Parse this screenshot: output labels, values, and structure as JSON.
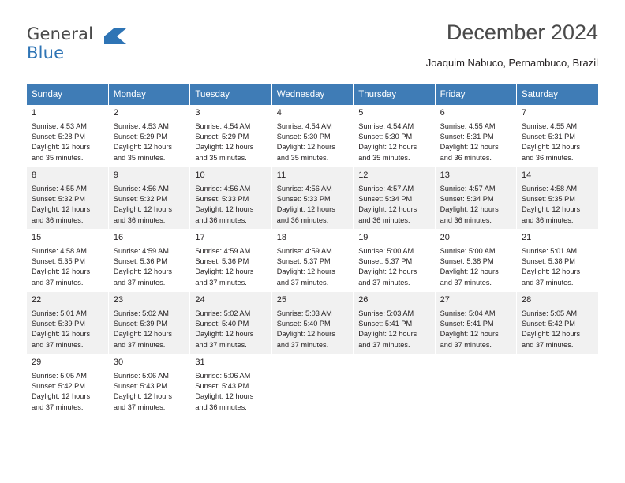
{
  "header": {
    "logo_general": "General",
    "logo_blue": "Blue",
    "logo_icon": "flag-icon",
    "title": "December 2024",
    "subtitle": "Joaquim Nabuco, Pernambuco, Brazil"
  },
  "calendar": {
    "weekday_headers": [
      "Sunday",
      "Monday",
      "Tuesday",
      "Wednesday",
      "Thursday",
      "Friday",
      "Saturday"
    ],
    "accent_color": "#3f7cb6",
    "shade_color": "#f1f1f1",
    "weeks": [
      [
        {
          "day": "1",
          "info": "Sunrise: 4:53 AM\nSunset: 5:28 PM\nDaylight: 12 hours\nand 35 minutes."
        },
        {
          "day": "2",
          "info": "Sunrise: 4:53 AM\nSunset: 5:29 PM\nDaylight: 12 hours\nand 35 minutes."
        },
        {
          "day": "3",
          "info": "Sunrise: 4:54 AM\nSunset: 5:29 PM\nDaylight: 12 hours\nand 35 minutes."
        },
        {
          "day": "4",
          "info": "Sunrise: 4:54 AM\nSunset: 5:30 PM\nDaylight: 12 hours\nand 35 minutes."
        },
        {
          "day": "5",
          "info": "Sunrise: 4:54 AM\nSunset: 5:30 PM\nDaylight: 12 hours\nand 35 minutes."
        },
        {
          "day": "6",
          "info": "Sunrise: 4:55 AM\nSunset: 5:31 PM\nDaylight: 12 hours\nand 36 minutes."
        },
        {
          "day": "7",
          "info": "Sunrise: 4:55 AM\nSunset: 5:31 PM\nDaylight: 12 hours\nand 36 minutes."
        }
      ],
      [
        {
          "day": "8",
          "info": "Sunrise: 4:55 AM\nSunset: 5:32 PM\nDaylight: 12 hours\nand 36 minutes."
        },
        {
          "day": "9",
          "info": "Sunrise: 4:56 AM\nSunset: 5:32 PM\nDaylight: 12 hours\nand 36 minutes."
        },
        {
          "day": "10",
          "info": "Sunrise: 4:56 AM\nSunset: 5:33 PM\nDaylight: 12 hours\nand 36 minutes."
        },
        {
          "day": "11",
          "info": "Sunrise: 4:56 AM\nSunset: 5:33 PM\nDaylight: 12 hours\nand 36 minutes."
        },
        {
          "day": "12",
          "info": "Sunrise: 4:57 AM\nSunset: 5:34 PM\nDaylight: 12 hours\nand 36 minutes."
        },
        {
          "day": "13",
          "info": "Sunrise: 4:57 AM\nSunset: 5:34 PM\nDaylight: 12 hours\nand 36 minutes."
        },
        {
          "day": "14",
          "info": "Sunrise: 4:58 AM\nSunset: 5:35 PM\nDaylight: 12 hours\nand 36 minutes."
        }
      ],
      [
        {
          "day": "15",
          "info": "Sunrise: 4:58 AM\nSunset: 5:35 PM\nDaylight: 12 hours\nand 37 minutes."
        },
        {
          "day": "16",
          "info": "Sunrise: 4:59 AM\nSunset: 5:36 PM\nDaylight: 12 hours\nand 37 minutes."
        },
        {
          "day": "17",
          "info": "Sunrise: 4:59 AM\nSunset: 5:36 PM\nDaylight: 12 hours\nand 37 minutes."
        },
        {
          "day": "18",
          "info": "Sunrise: 4:59 AM\nSunset: 5:37 PM\nDaylight: 12 hours\nand 37 minutes."
        },
        {
          "day": "19",
          "info": "Sunrise: 5:00 AM\nSunset: 5:37 PM\nDaylight: 12 hours\nand 37 minutes."
        },
        {
          "day": "20",
          "info": "Sunrise: 5:00 AM\nSunset: 5:38 PM\nDaylight: 12 hours\nand 37 minutes."
        },
        {
          "day": "21",
          "info": "Sunrise: 5:01 AM\nSunset: 5:38 PM\nDaylight: 12 hours\nand 37 minutes."
        }
      ],
      [
        {
          "day": "22",
          "info": "Sunrise: 5:01 AM\nSunset: 5:39 PM\nDaylight: 12 hours\nand 37 minutes."
        },
        {
          "day": "23",
          "info": "Sunrise: 5:02 AM\nSunset: 5:39 PM\nDaylight: 12 hours\nand 37 minutes."
        },
        {
          "day": "24",
          "info": "Sunrise: 5:02 AM\nSunset: 5:40 PM\nDaylight: 12 hours\nand 37 minutes."
        },
        {
          "day": "25",
          "info": "Sunrise: 5:03 AM\nSunset: 5:40 PM\nDaylight: 12 hours\nand 37 minutes."
        },
        {
          "day": "26",
          "info": "Sunrise: 5:03 AM\nSunset: 5:41 PM\nDaylight: 12 hours\nand 37 minutes."
        },
        {
          "day": "27",
          "info": "Sunrise: 5:04 AM\nSunset: 5:41 PM\nDaylight: 12 hours\nand 37 minutes."
        },
        {
          "day": "28",
          "info": "Sunrise: 5:05 AM\nSunset: 5:42 PM\nDaylight: 12 hours\nand 37 minutes."
        }
      ],
      [
        {
          "day": "29",
          "info": "Sunrise: 5:05 AM\nSunset: 5:42 PM\nDaylight: 12 hours\nand 37 minutes."
        },
        {
          "day": "30",
          "info": "Sunrise: 5:06 AM\nSunset: 5:43 PM\nDaylight: 12 hours\nand 37 minutes."
        },
        {
          "day": "31",
          "info": "Sunrise: 5:06 AM\nSunset: 5:43 PM\nDaylight: 12 hours\nand 36 minutes."
        },
        {
          "day": "",
          "info": ""
        },
        {
          "day": "",
          "info": ""
        },
        {
          "day": "",
          "info": ""
        },
        {
          "day": "",
          "info": ""
        }
      ]
    ]
  }
}
